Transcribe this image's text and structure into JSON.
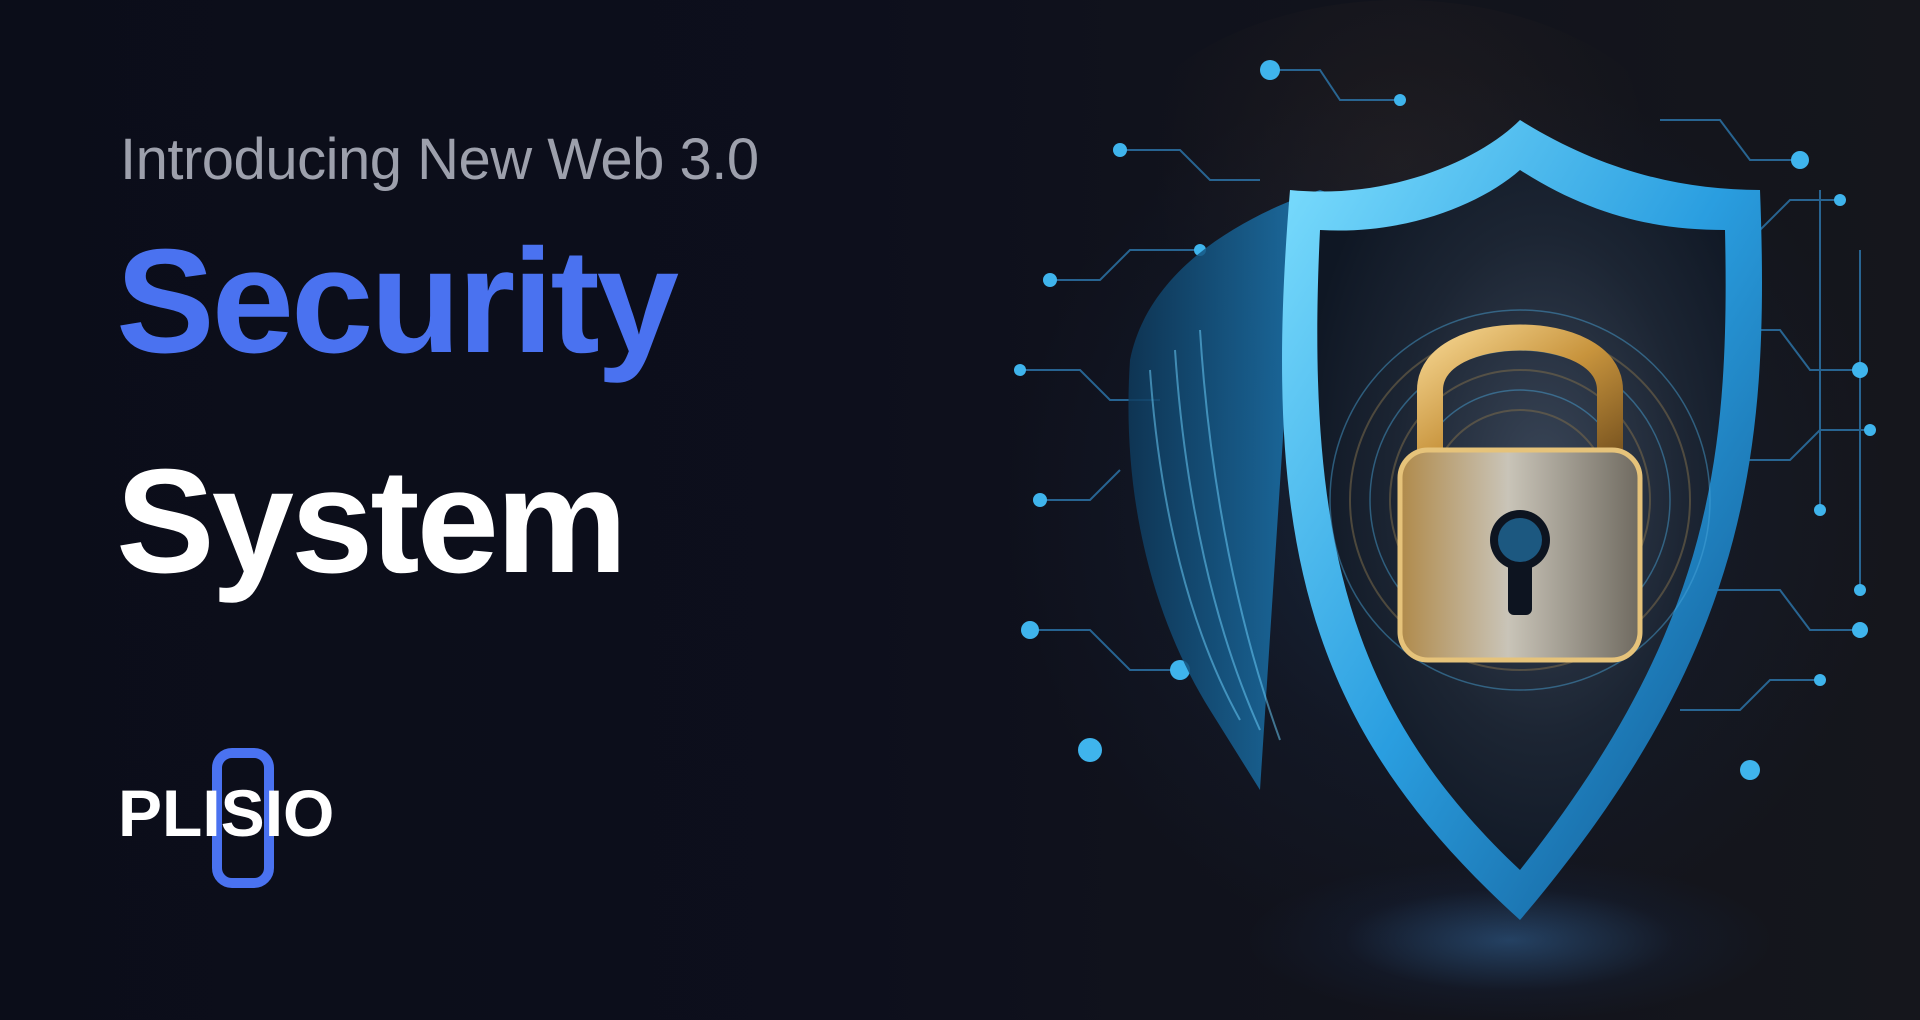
{
  "banner": {
    "kicker": "Introducing New Web 3.0",
    "headline_line_1": "Security",
    "headline_line_2": "System"
  },
  "brand": {
    "name": "PLISIO"
  },
  "illustration": {
    "icon": "shield-with-padlock-icon"
  },
  "colors": {
    "background": "#0c0e1a",
    "accent_blue": "#4a72f0",
    "kicker_grey": "#9da0ac",
    "headline_white": "#ffffff",
    "shield_cyan": "#38b6f0",
    "padlock_gold": "#d9a857"
  }
}
